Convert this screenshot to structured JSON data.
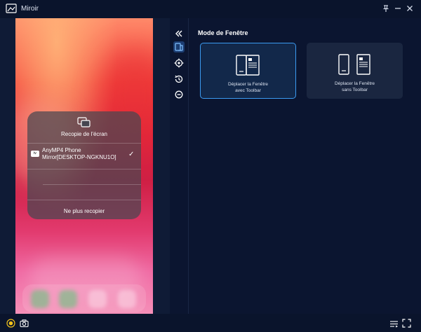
{
  "window": {
    "title": "Miroir"
  },
  "phone_screen": {
    "mirror_card": {
      "title": "Recopie de l'écran",
      "device_badge": "tv",
      "device_line1": "AnyMP4 Phone",
      "device_line2": "Mirror[DESKTOP-NGKNU1O]",
      "stop_label": "Ne plus recopier"
    }
  },
  "toolbar": {
    "items": [
      {
        "icon": "double-chevron-left-icon"
      },
      {
        "icon": "window-mode-icon",
        "active": true
      },
      {
        "icon": "settings-icon"
      },
      {
        "icon": "history-icon"
      },
      {
        "icon": "minus-circle-icon"
      }
    ]
  },
  "panel": {
    "title": "Mode de Fenêtre",
    "options": [
      {
        "line1": "Déplacer la Fenêtre",
        "line2": "avec Toolbar",
        "selected": true
      },
      {
        "line1": "Déplacer la Fenêtre",
        "line2": "sans Toolbar",
        "selected": false
      }
    ]
  },
  "colors": {
    "accent": "#3b9bf2",
    "background": "#0b1530",
    "record": "#f2c21b"
  }
}
